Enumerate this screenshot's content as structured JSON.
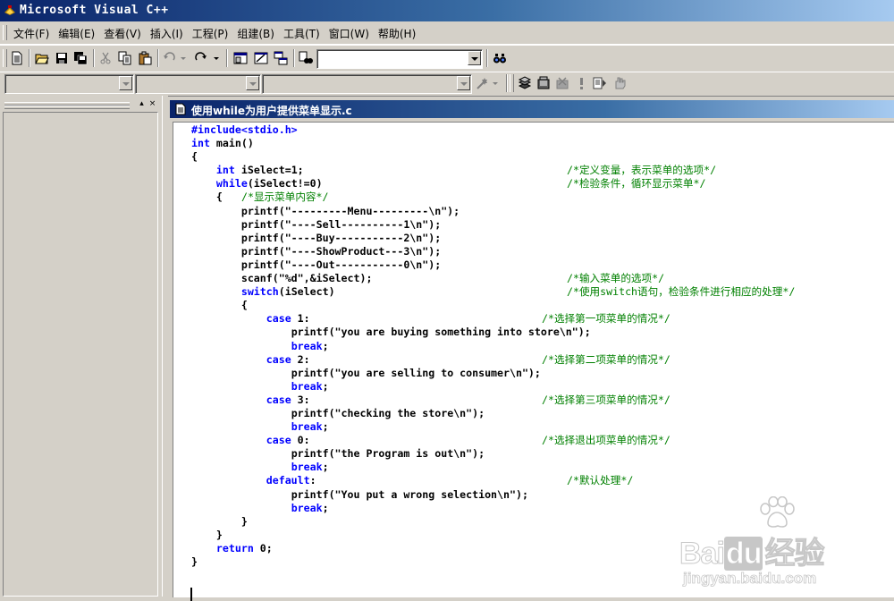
{
  "window": {
    "title": "Microsoft Visual C++"
  },
  "menu": [
    "文件(F)",
    "编辑(E)",
    "查看(V)",
    "插入(I)",
    "工程(P)",
    "组建(B)",
    "工具(T)",
    "窗口(W)",
    "帮助(H)"
  ],
  "toolbar": {
    "find_combo_value": ""
  },
  "toolbar2": {
    "combo1_value": "",
    "combo2_value": "",
    "combo3_value": ""
  },
  "document": {
    "title": "使用while为用户提供菜单显示.c"
  },
  "code_lines": [
    {
      "indent": 0,
      "tokens": [
        {
          "t": "#include<stdio.h>",
          "c": "kw"
        }
      ],
      "comment": ""
    },
    {
      "indent": 0,
      "tokens": [
        {
          "t": "int",
          "c": "kw"
        },
        {
          "t": " main()"
        }
      ],
      "comment": ""
    },
    {
      "indent": 0,
      "tokens": [
        {
          "t": "{"
        }
      ],
      "comment": ""
    },
    {
      "indent": 4,
      "tokens": [
        {
          "t": "int",
          "c": "kw"
        },
        {
          "t": " iSelect=1;"
        }
      ],
      "comment": "/*定义变量，表示菜单的选项*/",
      "ccol": 60
    },
    {
      "indent": 4,
      "tokens": [
        {
          "t": "while",
          "c": "kw"
        },
        {
          "t": "(iSelect!=0)"
        }
      ],
      "comment": "/*检验条件，循环显示菜单*/",
      "ccol": 60
    },
    {
      "indent": 4,
      "tokens": [
        {
          "t": "{   "
        }
      ],
      "comment": "/*显示菜单内容*/",
      "ccol": 8
    },
    {
      "indent": 8,
      "tokens": [
        {
          "t": "printf(\"---------Menu---------\\n\");"
        }
      ],
      "comment": ""
    },
    {
      "indent": 8,
      "tokens": [
        {
          "t": "printf(\"----Sell----------1\\n\");"
        }
      ],
      "comment": ""
    },
    {
      "indent": 8,
      "tokens": [
        {
          "t": "printf(\"----Buy-----------2\\n\");"
        }
      ],
      "comment": ""
    },
    {
      "indent": 8,
      "tokens": [
        {
          "t": "printf(\"----ShowProduct---3\\n\");"
        }
      ],
      "comment": ""
    },
    {
      "indent": 8,
      "tokens": [
        {
          "t": "printf(\"----Out-----------0\\n\");"
        }
      ],
      "comment": ""
    },
    {
      "indent": 8,
      "tokens": [
        {
          "t": "scanf(\"%d\",&iSelect);"
        }
      ],
      "comment": "/*输入菜单的选项*/",
      "ccol": 60
    },
    {
      "indent": 8,
      "tokens": [
        {
          "t": "switch",
          "c": "kw"
        },
        {
          "t": "(iSelect)"
        }
      ],
      "comment": "/*使用switch语句，检验条件进行相应的处理*/",
      "ccol": 60
    },
    {
      "indent": 8,
      "tokens": [
        {
          "t": "{"
        }
      ],
      "comment": ""
    },
    {
      "indent": 12,
      "tokens": [
        {
          "t": "case",
          "c": "kw"
        },
        {
          "t": " 1:"
        }
      ],
      "comment": "/*选择第一项菜单的情况*/",
      "ccol": 56
    },
    {
      "indent": 16,
      "tokens": [
        {
          "t": "printf(\"you are buying something into store\\n\");"
        }
      ],
      "comment": ""
    },
    {
      "indent": 16,
      "tokens": [
        {
          "t": "break",
          "c": "kw"
        },
        {
          "t": ";"
        }
      ],
      "comment": ""
    },
    {
      "indent": 12,
      "tokens": [
        {
          "t": "case",
          "c": "kw"
        },
        {
          "t": " 2:"
        }
      ],
      "comment": "/*选择第二项菜单的情况*/",
      "ccol": 56
    },
    {
      "indent": 16,
      "tokens": [
        {
          "t": "printf(\"you are selling to consumer\\n\");"
        }
      ],
      "comment": ""
    },
    {
      "indent": 16,
      "tokens": [
        {
          "t": "break",
          "c": "kw"
        },
        {
          "t": ";"
        }
      ],
      "comment": ""
    },
    {
      "indent": 12,
      "tokens": [
        {
          "t": "case",
          "c": "kw"
        },
        {
          "t": " 3:"
        }
      ],
      "comment": "/*选择第三项菜单的情况*/",
      "ccol": 56
    },
    {
      "indent": 16,
      "tokens": [
        {
          "t": "printf(\"checking the store\\n\");"
        }
      ],
      "comment": ""
    },
    {
      "indent": 16,
      "tokens": [
        {
          "t": "break",
          "c": "kw"
        },
        {
          "t": ";"
        }
      ],
      "comment": ""
    },
    {
      "indent": 12,
      "tokens": [
        {
          "t": "case",
          "c": "kw"
        },
        {
          "t": " 0:"
        }
      ],
      "comment": "/*选择退出项菜单的情况*/",
      "ccol": 56
    },
    {
      "indent": 16,
      "tokens": [
        {
          "t": "printf(\"the Program is out\\n\");"
        }
      ],
      "comment": ""
    },
    {
      "indent": 16,
      "tokens": [
        {
          "t": "break",
          "c": "kw"
        },
        {
          "t": ";"
        }
      ],
      "comment": ""
    },
    {
      "indent": 12,
      "tokens": [
        {
          "t": "default",
          "c": "kw"
        },
        {
          "t": ":"
        }
      ],
      "comment": "/*默认处理*/",
      "ccol": 60
    },
    {
      "indent": 16,
      "tokens": [
        {
          "t": "printf(\"You put a wrong selection\\n\");"
        }
      ],
      "comment": ""
    },
    {
      "indent": 16,
      "tokens": [
        {
          "t": "break",
          "c": "kw"
        },
        {
          "t": ";"
        }
      ],
      "comment": ""
    },
    {
      "indent": 8,
      "tokens": [
        {
          "t": "}"
        }
      ],
      "comment": ""
    },
    {
      "indent": 4,
      "tokens": [
        {
          "t": "}"
        }
      ],
      "comment": ""
    },
    {
      "indent": 4,
      "tokens": [
        {
          "t": "return",
          "c": "kw"
        },
        {
          "t": " 0;"
        }
      ],
      "comment": ""
    },
    {
      "indent": 0,
      "tokens": [
        {
          "t": "}"
        }
      ],
      "comment": ""
    }
  ],
  "watermark": {
    "brand": "Bai",
    "brand2": "du",
    "brand3": "经验",
    "url": "jingyan.baidu.com"
  }
}
